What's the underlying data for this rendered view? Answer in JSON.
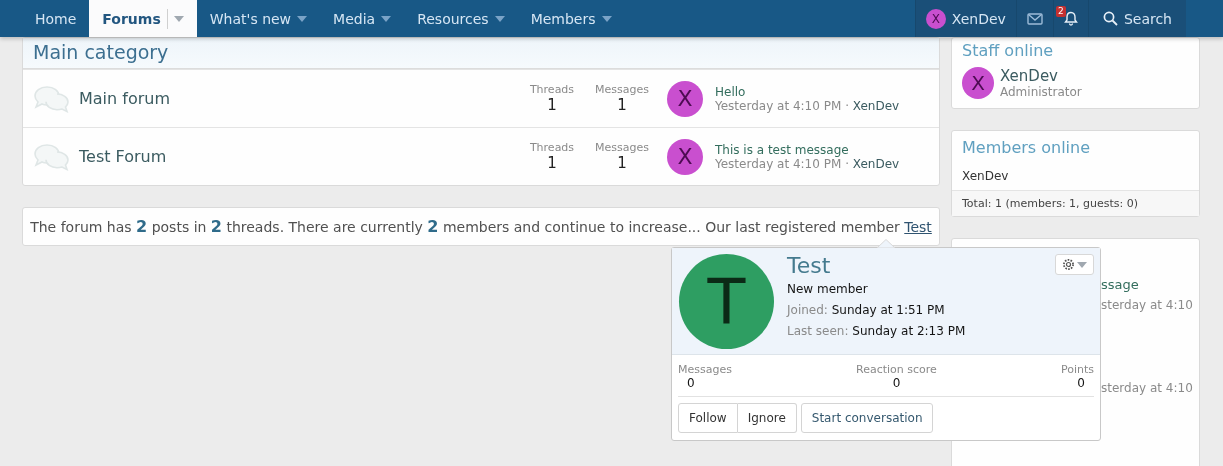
{
  "nav": {
    "tabs": [
      {
        "label": "Home",
        "selected": false,
        "dropdown": false
      },
      {
        "label": "Forums",
        "selected": true,
        "dropdown": true
      },
      {
        "label": "What's new",
        "selected": false,
        "dropdown": true
      },
      {
        "label": "Media",
        "selected": false,
        "dropdown": true
      },
      {
        "label": "Resources",
        "selected": false,
        "dropdown": true
      },
      {
        "label": "Members",
        "selected": false,
        "dropdown": true
      }
    ],
    "user": {
      "avatar_letter": "X",
      "color": "#c94fcf",
      "name": "XenDev"
    },
    "alerts_badge": "2",
    "search_label": "Search"
  },
  "category": {
    "title": "Main category",
    "forums": [
      {
        "title": "Main forum",
        "threads_label": "Threads",
        "threads": "1",
        "messages_label": "Messages",
        "messages": "1",
        "avatar_letter": "X",
        "color": "#c94fcf",
        "latest_title": "Hello",
        "latest_date": "Yesterday at 4:10 PM",
        "separator": "·",
        "latest_user": "XenDev"
      },
      {
        "title": "Test Forum",
        "threads_label": "Threads",
        "threads": "1",
        "messages_label": "Messages",
        "messages": "1",
        "avatar_letter": "X",
        "color": "#c94fcf",
        "latest_title": "This is a test message",
        "latest_date": "Yesterday at 4:10 PM",
        "separator": "·",
        "latest_user": "XenDev"
      }
    ]
  },
  "stats": {
    "sentence": "The forum has **2** posts in **2** threads. There are currently **2** members and continue to increase... Our last registered member",
    "member_link": "Test"
  },
  "sidebar": {
    "staff": {
      "title": "Staff online",
      "members": [
        {
          "avatar_letter": "X",
          "color": "#c94fcf",
          "name": "XenDev",
          "role": "Administrator"
        }
      ]
    },
    "online": {
      "title": "Members online",
      "members": [
        "XenDev"
      ],
      "total": "Total: 1 (members: 1, guests: 0)"
    },
    "covered_card": {
      "lines": [
        {
          "kind": "link",
          "text": "ssage"
        },
        {
          "kind": "date",
          "text": "sterday at 4:10"
        },
        {
          "kind": "date",
          "text": "sterday at 4:10"
        }
      ]
    }
  },
  "popup": {
    "avatar_letter": "T",
    "color": "#2e9e62",
    "name": "Test",
    "title": "New member",
    "facts": [
      {
        "label": "Joined:",
        "value": "Sunday at 1:51 PM"
      },
      {
        "label": "Last seen:",
        "value": "Sunday at 2:13 PM"
      }
    ],
    "stats": [
      {
        "label": "Messages",
        "value": "0"
      },
      {
        "label": "Reaction score",
        "value": "0"
      },
      {
        "label": "Points",
        "value": "0"
      }
    ],
    "buttons": [
      "Follow",
      "Ignore",
      "Start conversation"
    ]
  }
}
